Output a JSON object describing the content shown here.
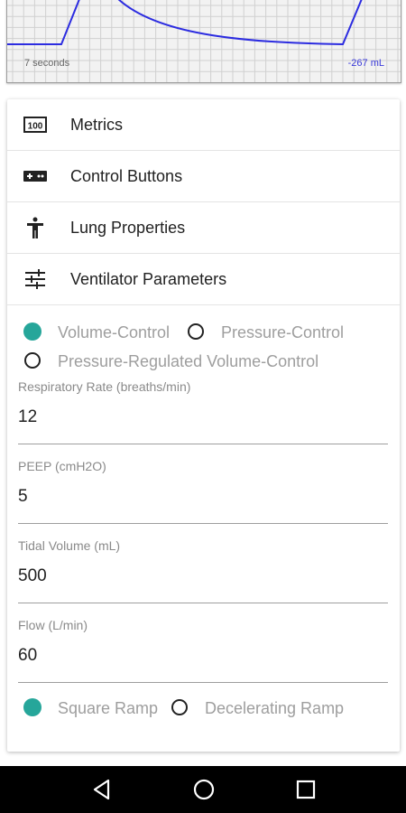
{
  "graph": {
    "time_label": "7 seconds",
    "volume_label": "-267 mL"
  },
  "menu": {
    "items": [
      {
        "label": "Metrics",
        "icon": "metrics-icon"
      },
      {
        "label": "Control Buttons",
        "icon": "gamepad-icon"
      },
      {
        "label": "Lung Properties",
        "icon": "person-icon"
      },
      {
        "label": "Ventilator Parameters",
        "icon": "sliders-icon"
      }
    ]
  },
  "params": {
    "mode_options": [
      {
        "label": "Volume-Control",
        "selected": true
      },
      {
        "label": "Pressure-Control",
        "selected": false
      },
      {
        "label": "Pressure-Regulated Volume-Control",
        "selected": false
      }
    ],
    "fields": [
      {
        "label": "Respiratory Rate (breaths/min)",
        "value": "12"
      },
      {
        "label": "PEEP (cmH2O)",
        "value": "5"
      },
      {
        "label": "Tidal Volume (mL)",
        "value": "500"
      },
      {
        "label": "Flow (L/min)",
        "value": "60"
      }
    ],
    "ramp_options": [
      {
        "label": "Square Ramp",
        "selected": true
      },
      {
        "label": "Decelerating Ramp",
        "selected": false
      }
    ]
  },
  "colors": {
    "accent": "#26a69a",
    "trace": "#2c2ce0"
  },
  "navigation": {
    "back_icon": "triangle-back-icon",
    "home_icon": "circle-home-icon",
    "recents_icon": "square-recents-icon"
  }
}
